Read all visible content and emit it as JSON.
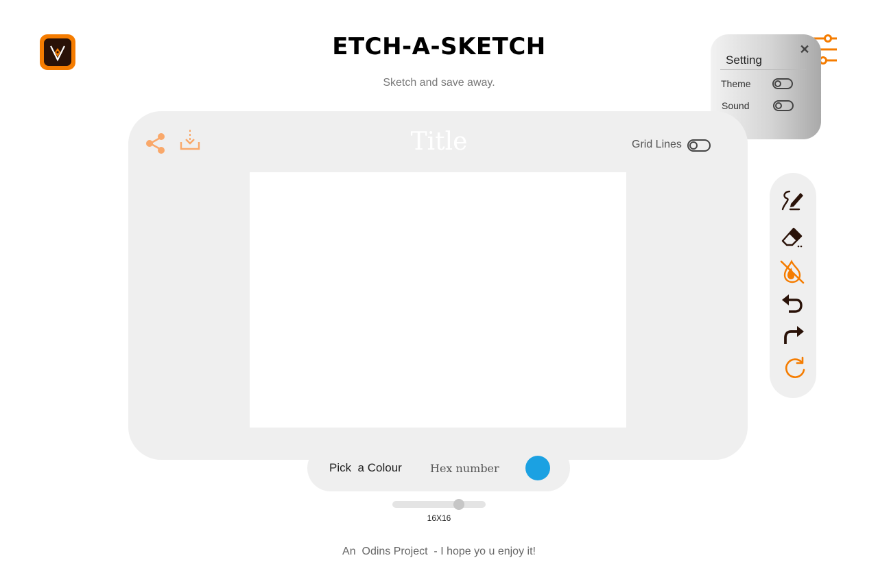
{
  "header": {
    "title": "ETCH-A-SKETCH",
    "subtitle": "Sketch and save away.",
    "logo_icon": "pen-nib-logo-icon",
    "settings_icon": "sliders-icon"
  },
  "settings_panel": {
    "title": "Setting",
    "close_icon": "close-icon",
    "close_glyph": "✕",
    "rows": [
      {
        "label": "Theme",
        "on": false
      },
      {
        "label": "Sound",
        "on": false
      }
    ]
  },
  "canvas_card": {
    "title": "Title",
    "share_icon": "share-icon",
    "download_icon": "download-icon",
    "grid_lines_label": "Grid Lines",
    "grid_lines_on": false
  },
  "tools": [
    {
      "name": "pen-tool-icon"
    },
    {
      "name": "eraser-tool-icon"
    },
    {
      "name": "rainbow-fill-tool-icon"
    },
    {
      "name": "undo-icon"
    },
    {
      "name": "redo-icon"
    },
    {
      "name": "reset-icon"
    }
  ],
  "colour_picker": {
    "label": "Pick  a Colour",
    "hex_placeholder": "Hex number",
    "selected_colour": "#1ba1e2"
  },
  "grid_size": {
    "label": "16X16",
    "value": 16,
    "slider_fraction": 0.71
  },
  "footer": {
    "text": "An  Odins Project  - I hope yo u enjoy it!"
  },
  "colors": {
    "accent": "#f57c00",
    "accent_light": "#f9a86a",
    "panel_grey": "#efefef",
    "dark_brown": "#2a1208"
  }
}
